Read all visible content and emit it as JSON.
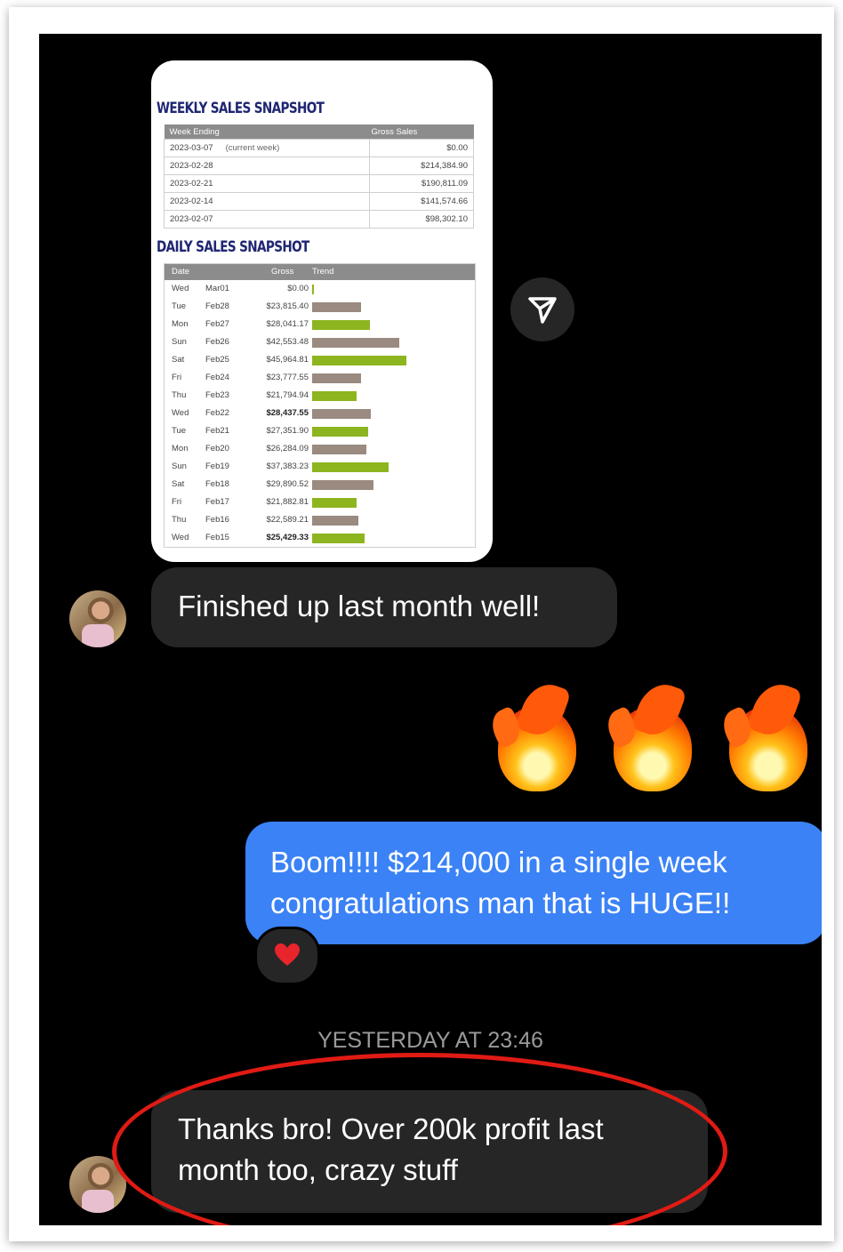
{
  "weekly": {
    "title": "WEEKLY SALES SNAPSHOT",
    "headers": [
      "Week Ending",
      "Gross Sales"
    ],
    "rows": [
      {
        "week": "2023-03-07",
        "note": "(current week)",
        "gross": "$0.00"
      },
      {
        "week": "2023-02-28",
        "note": "",
        "gross": "$214,384.90"
      },
      {
        "week": "2023-02-21",
        "note": "",
        "gross": "$190,811.09"
      },
      {
        "week": "2023-02-14",
        "note": "",
        "gross": "$141,574.66"
      },
      {
        "week": "2023-02-07",
        "note": "",
        "gross": "$98,302.10"
      }
    ]
  },
  "daily": {
    "title": "DAILY SALES SNAPSHOT",
    "headers": [
      "Date",
      "Gross",
      "Trend"
    ],
    "colors": {
      "up": "#8db51f",
      "down": "#9a8a80"
    },
    "rows": [
      {
        "day": "Wed",
        "date": "Mar01",
        "gross": "$0.00",
        "value": 0,
        "trend": "up",
        "bold": false
      },
      {
        "day": "Tue",
        "date": "Feb28",
        "gross": "$23,815.40",
        "value": 23815.4,
        "trend": "down",
        "bold": false
      },
      {
        "day": "Mon",
        "date": "Feb27",
        "gross": "$28,041.17",
        "value": 28041.17,
        "trend": "up",
        "bold": false
      },
      {
        "day": "Sun",
        "date": "Feb26",
        "gross": "$42,553.48",
        "value": 42553.48,
        "trend": "down",
        "bold": false
      },
      {
        "day": "Sat",
        "date": "Feb25",
        "gross": "$45,964.81",
        "value": 45964.81,
        "trend": "up",
        "bold": false
      },
      {
        "day": "Fri",
        "date": "Feb24",
        "gross": "$23,777.55",
        "value": 23777.55,
        "trend": "down",
        "bold": false
      },
      {
        "day": "Thu",
        "date": "Feb23",
        "gross": "$21,794.94",
        "value": 21794.94,
        "trend": "up",
        "bold": false
      },
      {
        "day": "Wed",
        "date": "Feb22",
        "gross": "$28,437.55",
        "value": 28437.55,
        "trend": "down",
        "bold": true
      },
      {
        "day": "Tue",
        "date": "Feb21",
        "gross": "$27,351.90",
        "value": 27351.9,
        "trend": "up",
        "bold": false
      },
      {
        "day": "Mon",
        "date": "Feb20",
        "gross": "$26,284.09",
        "value": 26284.09,
        "trend": "down",
        "bold": false
      },
      {
        "day": "Sun",
        "date": "Feb19",
        "gross": "$37,383.23",
        "value": 37383.23,
        "trend": "up",
        "bold": false
      },
      {
        "day": "Sat",
        "date": "Feb18",
        "gross": "$29,890.52",
        "value": 29890.52,
        "trend": "down",
        "bold": false
      },
      {
        "day": "Fri",
        "date": "Feb17",
        "gross": "$21,882.81",
        "value": 21882.81,
        "trend": "up",
        "bold": false
      },
      {
        "day": "Thu",
        "date": "Feb16",
        "gross": "$22,589.21",
        "value": 22589.21,
        "trend": "down",
        "bold": false
      },
      {
        "day": "Wed",
        "date": "Feb15",
        "gross": "$25,429.33",
        "value": 25429.33,
        "trend": "up",
        "bold": true
      }
    ]
  },
  "messages": {
    "received_1": "Finished up last month well!",
    "sent_line_1": "Boom!!!! $214,000 in a single week",
    "sent_line_2": "congratulations man that is HUGE!!",
    "timestamp": "YESTERDAY AT 23:46",
    "received_2_line_1": "Thanks bro! Over 200k profit last",
    "received_2_line_2": "month too, crazy stuff"
  },
  "icons": {
    "share": "paper-plane-icon",
    "reaction": "heart-icon",
    "emoji": "fire-emoji"
  },
  "colors": {
    "background": "#000000",
    "bubble_received": "#262626",
    "bubble_sent": "#3b82f6",
    "highlight_circle": "#e01b14",
    "heart": "#e8242c"
  }
}
